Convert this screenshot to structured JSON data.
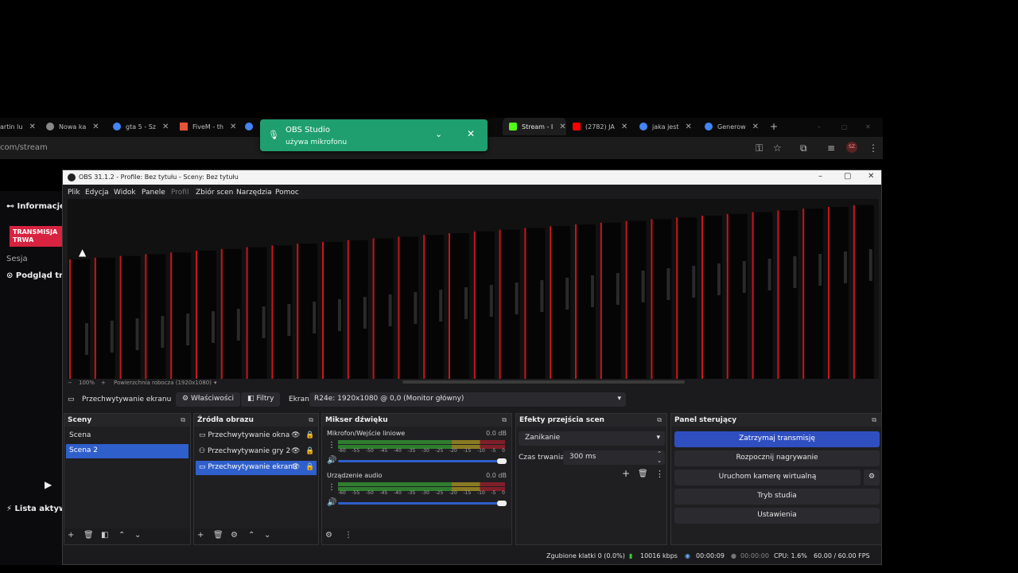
{
  "browser": {
    "tabs": [
      {
        "label": "artin lu",
        "icon": "favicon-icon"
      },
      {
        "label": "Nowa ka",
        "icon": "shield-icon"
      },
      {
        "label": "gta 5 - Sz",
        "icon": "google-icon"
      },
      {
        "label": "FiveM - th",
        "icon": "fivem-icon"
      },
      {
        "label": "Stream - I",
        "icon": "kick-icon",
        "active": true
      },
      {
        "label": "(2782) JA",
        "icon": "youtube-icon"
      },
      {
        "label": "jaka jest",
        "icon": "google-icon"
      },
      {
        "label": "Generow",
        "icon": "google-icon"
      }
    ],
    "url": "com/stream",
    "profile_initials": "SZ"
  },
  "notification": {
    "title": "OBS Studio",
    "subtitle": "używa mikrofonu"
  },
  "page_behind": {
    "info_label": "Informacje o",
    "live_badge": "TRANSMISJA TRWA",
    "session_label": "Sesja",
    "preview_label": "Podgląd tra",
    "activity_label": "Lista aktywn"
  },
  "obs": {
    "title": "OBS 31.1.2 - Profile: Bez tytułu - Sceny: Bez tytułu",
    "menu": [
      "Plik",
      "Edycja",
      "Widok",
      "Panele",
      "Profil",
      "Zbiór scen",
      "Narzędzia",
      "Pomoc"
    ],
    "preview_footer": {
      "zoom": "100%",
      "canvas": "Powierzchnia robocza (1920x1080)"
    },
    "source_bar": {
      "source_name": "Przechwytywanie ekranu",
      "properties": "Właściwości",
      "filters": "Filtry",
      "screen_label": "Ekran",
      "screen_value": "R24e: 1920x1080 @ 0,0 (Monitor główny)"
    },
    "scenes": {
      "title": "Sceny",
      "items": [
        {
          "label": "Scena"
        },
        {
          "label": "Scena 2",
          "selected": true
        }
      ]
    },
    "sources": {
      "title": "Źródła obrazu",
      "items": [
        {
          "label": "Przechwytywanie okna",
          "icon": "window-icon"
        },
        {
          "label": "Przechwytywanie gry 2",
          "icon": "gamepad-icon"
        },
        {
          "label": "Przechwytywanie ekranu",
          "icon": "monitor-icon",
          "selected": true
        }
      ]
    },
    "mixer": {
      "title": "Mikser dźwięku",
      "channels": [
        {
          "name": "Mikrofon/Wejście liniowe",
          "db": "0.0 dB",
          "volume": 1.0
        },
        {
          "name": "Urządzenie audio",
          "db": "0.0 dB",
          "volume": 1.0
        }
      ],
      "ticks": [
        "-60",
        "-55",
        "-50",
        "-45",
        "-40",
        "-35",
        "-30",
        "-25",
        "-20",
        "-15",
        "-10",
        "-5",
        "0"
      ]
    },
    "transitions": {
      "title": "Efekty przejścia scen",
      "selected": "Zanikanie",
      "duration_label": "Czas trwania",
      "duration_value": "300 ms"
    },
    "controls": {
      "title": "Panel sterujący",
      "buttons": [
        "Zatrzymaj transmisję",
        "Rozpocznij nagrywanie",
        "Uruchom kamerę wirtualną",
        "Tryb studia",
        "Ustawienia"
      ]
    },
    "status": {
      "dropped": "Zgubione klatki 0 (0.0%)",
      "bitrate": "10016 kbps",
      "stream_time": "00:00:09",
      "rec_time": "00:00:00",
      "cpu": "CPU: 1.6%",
      "fps": "60.00 / 60.00 FPS"
    }
  }
}
